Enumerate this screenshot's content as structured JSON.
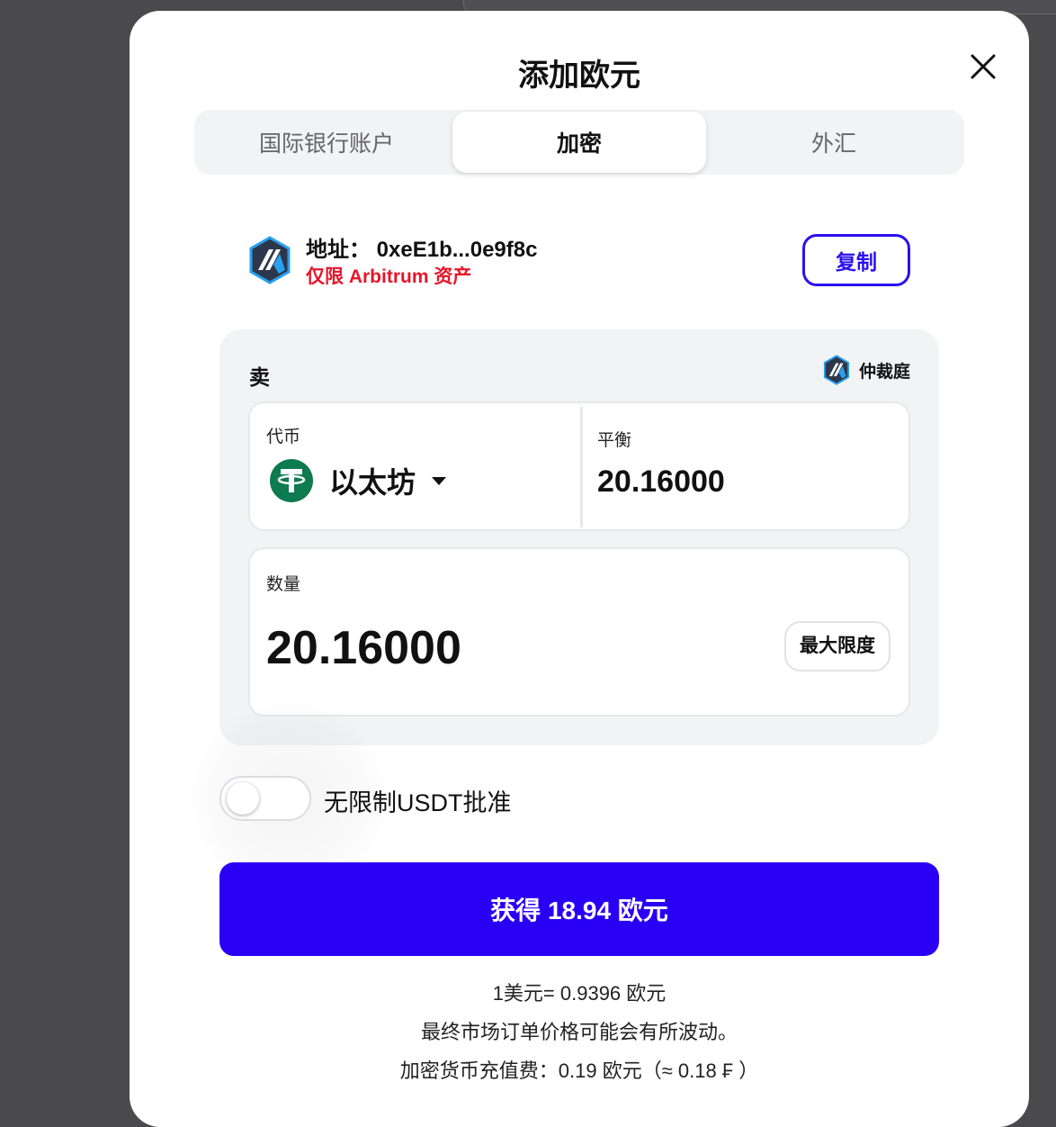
{
  "modal": {
    "title": "添加欧元"
  },
  "tabs": [
    "国际银行账户",
    "加密",
    "外汇"
  ],
  "address": {
    "text": "地址： 0xeE1b...0e9f8c",
    "warning": "仅限 Arbitrum 资产",
    "copy_label": "复制"
  },
  "sell": {
    "label": "卖",
    "network": "仲裁庭",
    "token_label": "代币",
    "token_name": "以太坊",
    "balance_label": "平衡",
    "balance_value": "20.16000",
    "quantity_label": "数量",
    "quantity_value": "20.16000",
    "max_label": "最大限度"
  },
  "approval": {
    "label": "无限制USDT批准",
    "enabled": false
  },
  "submit": {
    "label": "获得 18.94 欧元"
  },
  "info": {
    "rate": "1美元= 0.9396 欧元",
    "notice": "最终市场订单价格可能会有所波动。",
    "fee": "加密货币充值费：0.19 欧元（≈ 0.18 ₣ ）"
  },
  "colors": {
    "primary": "#2a00f5",
    "warning": "#e5162a",
    "usdt_green": "#0e7a4f"
  },
  "icons": {
    "close": "close-icon",
    "network": "arbitrum-icon",
    "token": "tether-icon",
    "dropdown": "caret-down-icon"
  }
}
